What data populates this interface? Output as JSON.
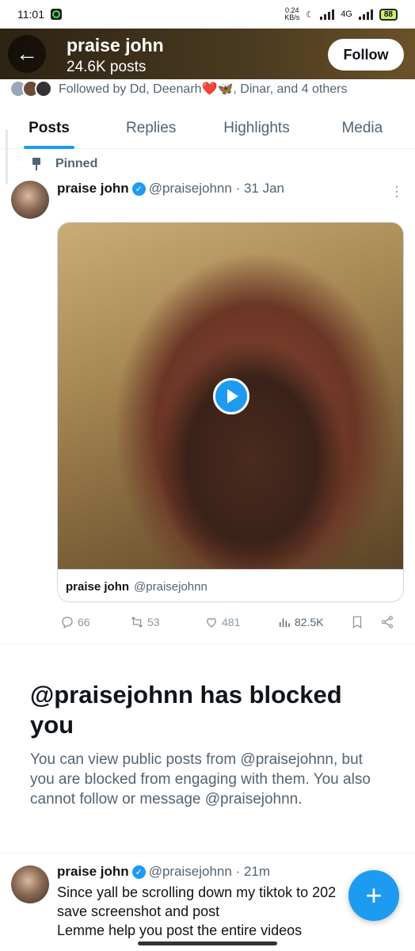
{
  "status_bar": {
    "time": "11:01",
    "speed": "0.24",
    "speed_unit": "KB/s",
    "network": "4G",
    "battery": "88"
  },
  "header": {
    "name": "praise john",
    "post_count": "24.6K posts",
    "follow_label": "Follow"
  },
  "followed_by": {
    "text": "Followed by Dd, Deenarh❤️🦋, Dinar, and 4 others"
  },
  "tabs": [
    {
      "label": "Posts",
      "active": true
    },
    {
      "label": "Replies",
      "active": false
    },
    {
      "label": "Highlights",
      "active": false
    },
    {
      "label": "Media",
      "active": false
    }
  ],
  "pinned_post": {
    "pinned_label": "Pinned",
    "name": "praise john",
    "handle_time": "@praisejohnn · 31 Jan",
    "quote_name": "praise john",
    "quote_handle": "@praisejohnn",
    "stats": {
      "replies": "66",
      "reposts": "53",
      "likes": "481",
      "views": "82.5K"
    }
  },
  "blocked_notice": {
    "title": "@praisejohnn has blocked you",
    "body": "You can view public posts from @praisejohnn, but you are blocked from engaging with them. You also cannot follow or message @praisejohnn."
  },
  "second_post": {
    "name": "praise john",
    "handle_time": "@praisejohnn · 21m",
    "lines": [
      "Since yall be scrolling down my tiktok to 202",
      "save screenshot and post",
      "Lemme help you post the entire videos"
    ]
  },
  "icons": {
    "back": "arrow-left-icon",
    "verified": "verified-badge-icon",
    "pin": "pin-icon",
    "play": "play-icon",
    "compose": "plus-icon"
  },
  "colors": {
    "accent": "#1d9bf0",
    "text": "#0f1419",
    "muted": "#536471"
  }
}
